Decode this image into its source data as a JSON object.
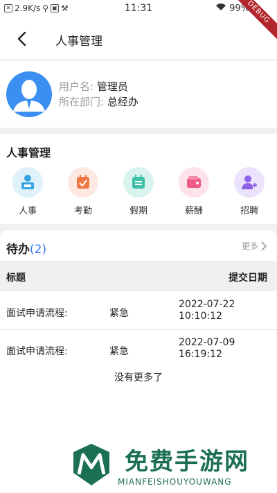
{
  "status_bar": {
    "speed": "2.9K/s",
    "time": "11:31",
    "battery": "99%",
    "debug_label": "DEBUG"
  },
  "nav": {
    "title": "人事管理",
    "back_icon": "chevron-left-icon"
  },
  "profile": {
    "username_label": "用户名:",
    "username_value": "管理员",
    "dept_label": "所在部门:",
    "dept_value": "总经办"
  },
  "hr_section": {
    "title": "人事管理",
    "items": [
      {
        "label": "人事",
        "icon": "personnel-icon",
        "bg": "#dff1fb",
        "color": "#39a5e0"
      },
      {
        "label": "考勤",
        "icon": "attendance-icon",
        "bg": "#fde9e1",
        "color": "#f07845"
      },
      {
        "label": "假期",
        "icon": "vacation-icon",
        "bg": "#d9f3ef",
        "color": "#3fbfa9"
      },
      {
        "label": "薪酬",
        "icon": "salary-icon",
        "bg": "#fde2ea",
        "color": "#ef5a86"
      },
      {
        "label": "招聘",
        "icon": "recruit-icon",
        "bg": "#ebe2fb",
        "color": "#8f63e9"
      }
    ]
  },
  "todo": {
    "title": "待办",
    "count": "(2)",
    "more_label": "更多",
    "columns": [
      "标题",
      "提交日期"
    ],
    "rows": [
      {
        "title": "面试申请流程:",
        "priority": "紧急",
        "date": "2022-07-22",
        "time": "10:10:12"
      },
      {
        "title": "面试申请流程:",
        "priority": "紧急",
        "date": "2022-07-09",
        "time": "16:19:12"
      }
    ],
    "no_more": "没有更多了"
  },
  "watermark": {
    "text": "免费手游网",
    "sub": "MIANFEISHOUYOUWANG"
  }
}
